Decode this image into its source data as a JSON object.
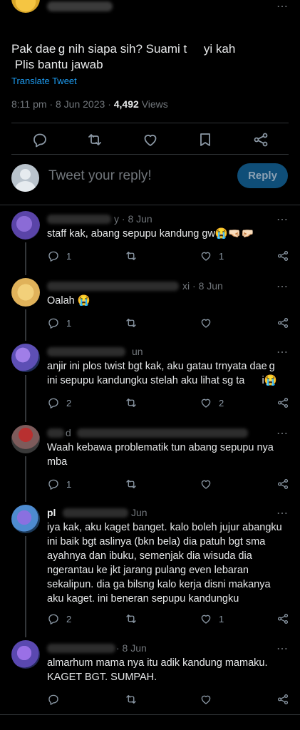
{
  "tweet": {
    "lines": [
      "Pak dae g nih siapa sih? Suami t     yi kah",
      " Plis bantu jawab"
    ],
    "translate_label": "Translate Tweet",
    "time": "8:11 pm",
    "date": "8 Jun 2023",
    "views_count": "4,492",
    "views_label": "Views"
  },
  "reply_box": {
    "placeholder": "Tweet your reply!",
    "button_label": "Reply"
  },
  "replies": [
    {
      "name_suffix": "y",
      "date": "· 8 Jun",
      "lines": [
        "staff kak, abang sepupu kandung gw😭🤜🏻🤛🏻"
      ],
      "reply_count": "1",
      "like_count": "1"
    },
    {
      "name_suffix": "xi",
      "date": "· 8 Jun",
      "lines": [
        "Oalah 😭"
      ],
      "reply_count": "1",
      "like_count": ""
    },
    {
      "name_suffix": "",
      "date": "un",
      "lines": [
        "anjir ini plos twist bgt kak, aku gatau trnyata dae g",
        "ini sepupu kandungku stelah aku lihat sg ta      i😭"
      ],
      "reply_count": "2",
      "like_count": "2"
    },
    {
      "name_suffix": "d",
      "date": "",
      "lines": [
        "Waah kebawa problematik tun abang sepupu nya",
        "mba"
      ],
      "reply_count": "1",
      "like_count": ""
    },
    {
      "name_suffix": "pl",
      "date": "Jun",
      "lines": [
        "iya kak, aku kaget banget. kalo boleh jujur abangku",
        "ini baik bgt aslinya (bkn bela) dia patuh bgt sma",
        "ayahnya dan ibuku, semenjak dia wisuda dia",
        "ngerantau ke jkt jarang pulang even lebaran",
        "sekalipun. dia ga bilsng kalo kerja disni makanya",
        "aku kaget. ini beneran sepupu kandungku"
      ],
      "reply_count": "2",
      "like_count": "1"
    },
    {
      "name_suffix": "",
      "date": "· 8 Jun",
      "lines": [
        "almarhum mama nya itu adik kandung mamaku.",
        "KAGET BGT. SUMPAH."
      ],
      "reply_count": "",
      "like_count": ""
    }
  ],
  "icons": {
    "reply": "speech-bubble-icon",
    "retweet": "retweet-icon",
    "like": "heart-icon",
    "bookmark": "bookmark-icon",
    "share": "share-icon",
    "more": "more-dots-icon"
  },
  "colors": {
    "background": "#000000",
    "text": "#e7e9ea",
    "muted": "#71767b",
    "link": "#1d9bf0",
    "reply_button": "#0f4e78"
  }
}
